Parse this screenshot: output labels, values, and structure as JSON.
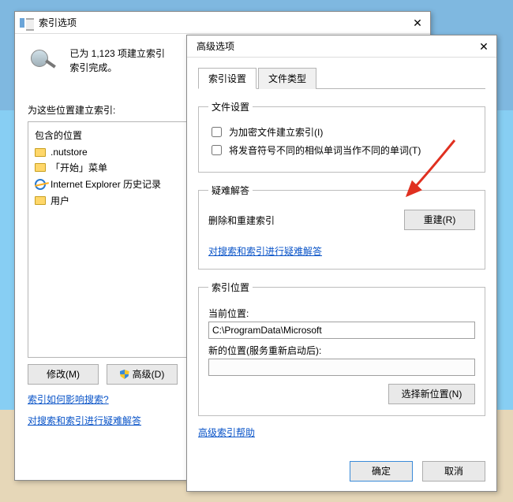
{
  "main_dialog": {
    "title": "索引选项",
    "status_line1": "已为 1,123 项建立索引",
    "status_line2": "索引完成。",
    "section_label": "为这些位置建立索引:",
    "listbox_header": "包含的位置",
    "items": [
      {
        "icon": "folder",
        "label": ".nutstore"
      },
      {
        "icon": "folder",
        "label": "「开始」菜单"
      },
      {
        "icon": "ie",
        "label": "Internet Explorer 历史记录"
      },
      {
        "icon": "folder",
        "label": "用户"
      }
    ],
    "btn_modify": "修改(M)",
    "btn_advanced": "高级(D)",
    "link_howaffect": "索引如何影响搜索?",
    "link_trouble": "对搜索和索引进行疑难解答"
  },
  "adv_dialog": {
    "title": "高级选项",
    "tabs": {
      "idx_settings": "索引设置",
      "file_types": "文件类型"
    },
    "file_settings": {
      "legend": "文件设置",
      "encrypt": "为加密文件建立索引(I)",
      "diacritics": "将发音符号不同的相似单词当作不同的单词(T)"
    },
    "troubleshoot": {
      "legend": "疑难解答",
      "rebuild_label": "删除和重建索引",
      "btn_rebuild": "重建(R)",
      "link": "对搜索和索引进行疑难解答"
    },
    "index_loc": {
      "legend": "索引位置",
      "current_label": "当前位置:",
      "current_value": "C:\\ProgramData\\Microsoft",
      "new_label": "新的位置(服务重新启动后):",
      "new_value": "",
      "btn_choose": "选择新位置(N)"
    },
    "link_help": "高级索引帮助",
    "btn_ok": "确定",
    "btn_cancel": "取消"
  }
}
